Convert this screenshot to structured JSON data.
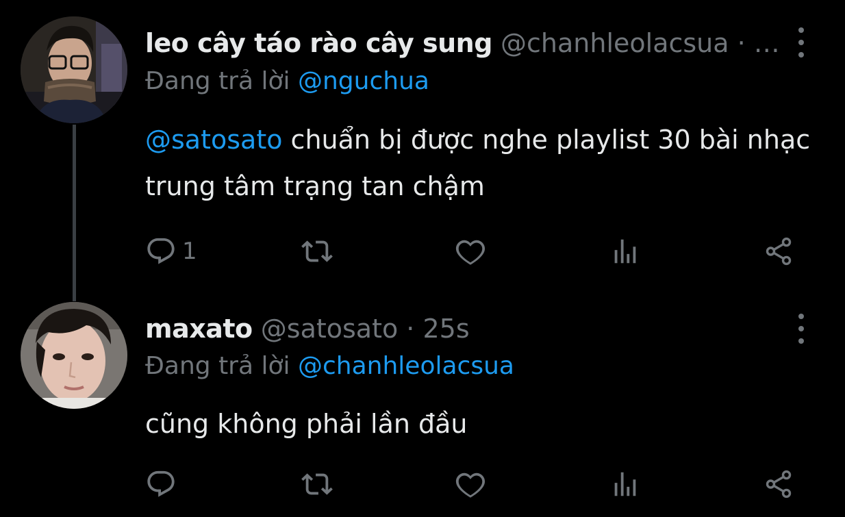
{
  "tweets": [
    {
      "display_name": "leo cây táo rào cây sung",
      "handle_meta": "@chanhleolacsua · …",
      "reply_prefix": "Đang trả lời",
      "reply_to": "@nguchua",
      "mention": "@satosato",
      "text": " chuẩn bị được nghe playlist 30 bài nhạc trung tâm trạng tan chậm",
      "reply_count": "1",
      "retweet_count": "",
      "like_count": ""
    },
    {
      "display_name": "maxato",
      "handle_meta": "@satosato · 25s",
      "reply_prefix": "Đang trả lời",
      "reply_to": "@chanhleolacsua",
      "mention": "",
      "text": "cũng không phải lần đầu",
      "reply_count": "",
      "retweet_count": "",
      "like_count": ""
    }
  ],
  "colors": {
    "background": "#000000",
    "text": "#e7e9ea",
    "muted": "#71767b",
    "link": "#1d9bf0",
    "thread_line": "#3a3f44"
  },
  "icons": [
    "reply-icon",
    "retweet-icon",
    "like-icon",
    "views-icon",
    "share-icon",
    "more-options-icon"
  ]
}
